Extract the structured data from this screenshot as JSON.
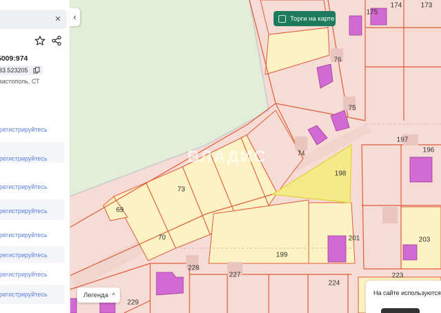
{
  "panel": {
    "cad_num": "5009:974",
    "coords": "33.523205",
    "address": "вастополь, СТ",
    "register_link": "арегистрируйтесь"
  },
  "map": {
    "auction_button": "Торги на карте",
    "watermark": "ВЛАДИС",
    "legend_button": "Легенда",
    "cookie_text": "На сайте используются",
    "parcels": [
      "175",
      "174",
      "173",
      "76",
      "75",
      "197",
      "196",
      "74",
      "198",
      "73",
      "69",
      "70",
      "201",
      "203",
      "199",
      "228",
      "227",
      "224",
      "223",
      "229"
    ]
  },
  "colors": {
    "parcel_fill": "#fdf2c3",
    "selected_fill": "#f5ea8a",
    "boundary": "#e05a3a",
    "building": "#d36ad4",
    "greenery": "#e2eed8",
    "accent_button": "#1d7a5c",
    "link": "#5b7fe0"
  }
}
